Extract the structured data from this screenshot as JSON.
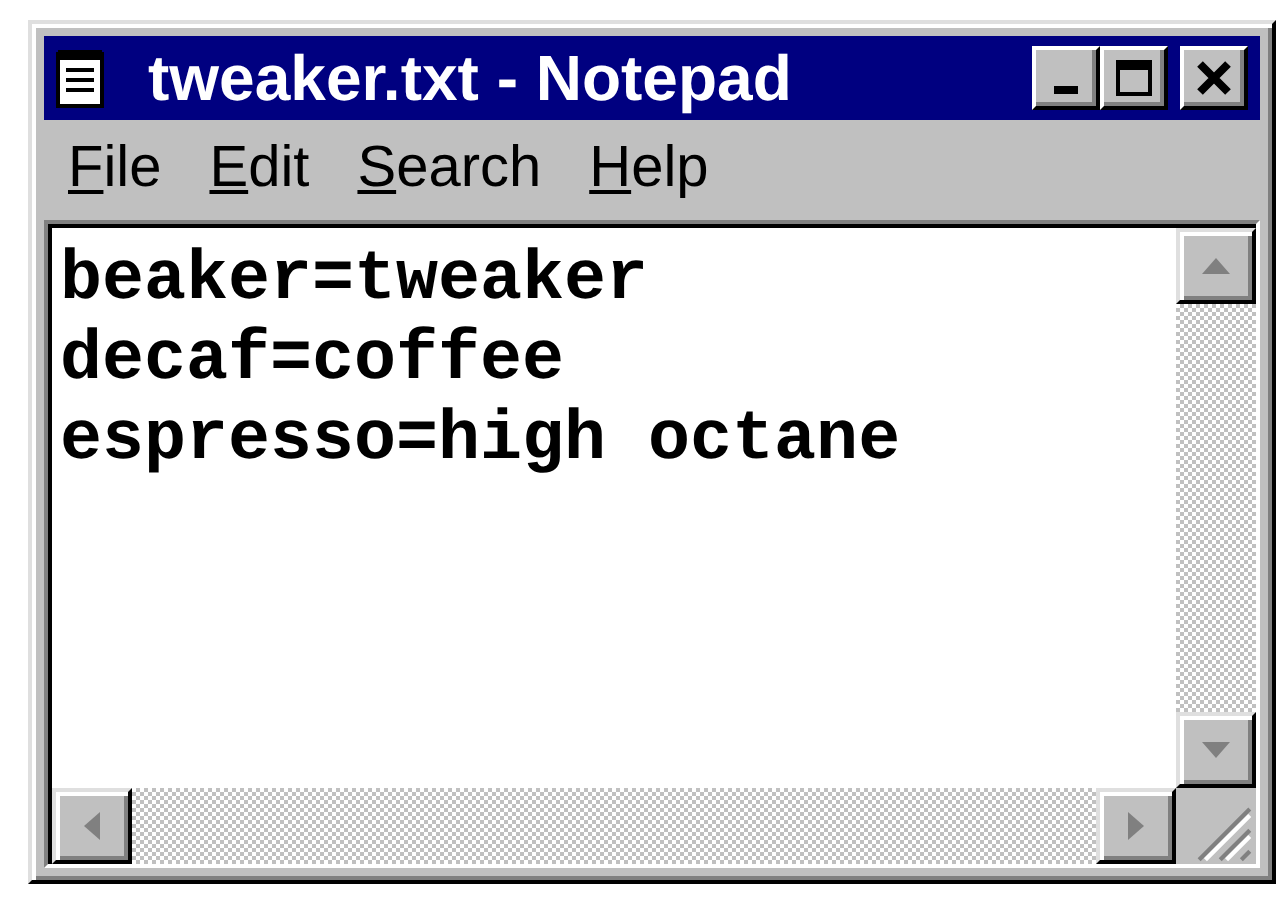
{
  "window": {
    "title": "tweaker.txt - Notepad"
  },
  "menu": [
    {
      "label": "File"
    },
    {
      "label": "Edit"
    },
    {
      "label": "Search"
    },
    {
      "label": "Help"
    }
  ],
  "document": {
    "lines": [
      "beaker=tweaker",
      "decaf=coffee",
      "espresso=high octane"
    ]
  }
}
